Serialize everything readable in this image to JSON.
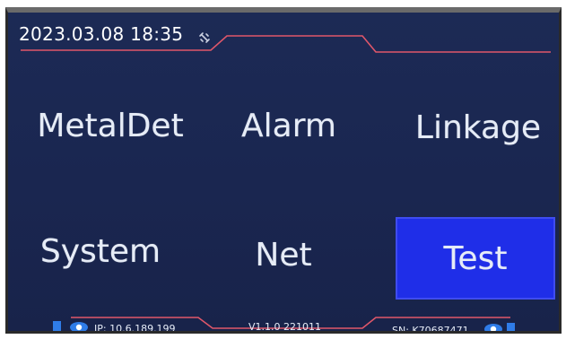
{
  "status_bar": {
    "datetime": "2023.03.08 18:35",
    "network_icon": "link-broken-icon"
  },
  "menu": {
    "items": [
      {
        "label": "MetalDet",
        "selected": false
      },
      {
        "label": "Alarm",
        "selected": false
      },
      {
        "label": "Linkage",
        "selected": false
      },
      {
        "label": "System",
        "selected": false
      },
      {
        "label": "Net",
        "selected": false
      },
      {
        "label": "Test",
        "selected": true
      }
    ]
  },
  "footer": {
    "ip": "IP: 10.6.189.199",
    "version": "V1.1.0 221011",
    "serial": "SN: K70687471",
    "icons": [
      "status-square-icon",
      "eye-icon"
    ]
  },
  "colors": {
    "background": "#1a2650",
    "accent_line": "#e0576a",
    "selected": "#1f2ee8",
    "indicator": "#2f7ce8"
  }
}
